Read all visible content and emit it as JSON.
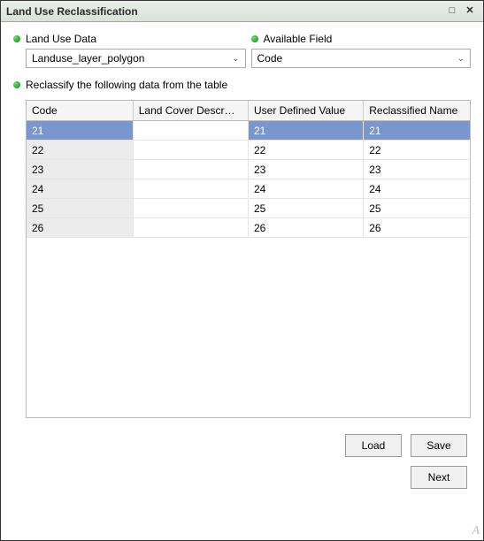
{
  "window": {
    "title": "Land Use Reclassification",
    "maximize_glyph": "□",
    "close_glyph": "✕"
  },
  "fields": {
    "land_use_label": "Land Use Data",
    "land_use_value": "Landuse_layer_polygon",
    "available_label": "Available Field",
    "available_value": "Code",
    "reclass_label": "Reclassify the following data from the table"
  },
  "table": {
    "headers": {
      "code": "Code",
      "desc": "Land Cover Descr…",
      "user": "User Defined Value",
      "reclass": "Reclassified Name"
    },
    "rows": [
      {
        "code": "21",
        "desc": "",
        "user": "21",
        "reclass": "21",
        "selected": true
      },
      {
        "code": "22",
        "desc": "",
        "user": "22",
        "reclass": "22",
        "selected": false
      },
      {
        "code": "23",
        "desc": "",
        "user": "23",
        "reclass": "23",
        "selected": false
      },
      {
        "code": "24",
        "desc": "",
        "user": "24",
        "reclass": "24",
        "selected": false
      },
      {
        "code": "25",
        "desc": "",
        "user": "25",
        "reclass": "25",
        "selected": false
      },
      {
        "code": "26",
        "desc": "",
        "user": "26",
        "reclass": "26",
        "selected": false
      }
    ]
  },
  "buttons": {
    "load": "Load",
    "save": "Save",
    "next": "Next"
  },
  "corner": "A"
}
